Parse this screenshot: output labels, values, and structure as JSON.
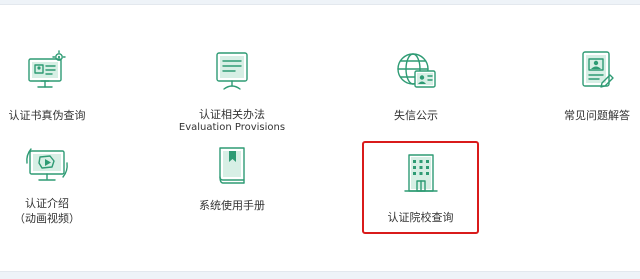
{
  "colors": {
    "accent": "#2e9b74",
    "highlight_border": "#d91b1b",
    "background": "#eef3f8"
  },
  "tiles": [
    {
      "label": "认证书真伪查询",
      "icon": "certificate-computer-icon"
    },
    {
      "label": "认证相关办法",
      "sublabel": "Evaluation Provisions",
      "icon": "document-board-icon"
    },
    {
      "label": "失信公示",
      "icon": "globe-id-card-icon"
    },
    {
      "label": "常见问题解答",
      "icon": "id-document-icon"
    },
    {
      "label": "认证介绍",
      "sublabel": "（动画视频）",
      "icon": "video-monitor-icon"
    },
    {
      "label": "系统使用手册",
      "icon": "manual-book-icon"
    },
    {
      "label": "认证院校查询",
      "icon": "building-icon",
      "highlighted": true
    }
  ]
}
